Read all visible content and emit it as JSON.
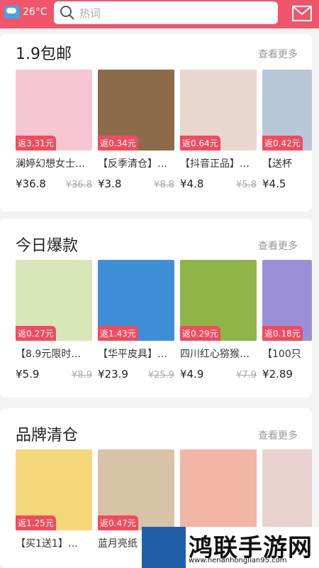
{
  "header": {
    "temperature": "26°C",
    "search_placeholder": "热词"
  },
  "sections": [
    {
      "title": "1.9包邮",
      "more": "查看更多",
      "items": [
        {
          "rebate": "返3.31元",
          "name": "澜婷幻想女士…",
          "price": "¥36.8",
          "original": "¥36.8",
          "color": "#f7c6d3"
        },
        {
          "rebate": "返0.34元",
          "name": "【反季清仓】…",
          "price": "¥3.8",
          "original": "¥8.8",
          "color": "#8c6b4b"
        },
        {
          "rebate": "返0.64元",
          "name": "【抖音正品】…",
          "price": "¥4.8",
          "original": "¥5.8",
          "color": "#e9d6cf"
        },
        {
          "rebate": "返0.42元",
          "name": "【送杯",
          "price": "¥4.5",
          "original": "",
          "color": "#b7c7d8"
        }
      ]
    },
    {
      "title": "今日爆款",
      "more": "查看更多",
      "items": [
        {
          "rebate": "返0.27元",
          "name": "【8.9元限时…",
          "price": "¥5.9",
          "original": "¥8.9",
          "color": "#d7e6b6"
        },
        {
          "rebate": "返1.43元",
          "name": "【华平皮具】…",
          "price": "¥23.9",
          "original": "¥25.9",
          "color": "#3f8fd8"
        },
        {
          "rebate": "返0.29元",
          "name": "四川红心猕猴…",
          "price": "¥4.9",
          "original": "¥7.9",
          "color": "#8fb548"
        },
        {
          "rebate": "返0.18元",
          "name": "【100只",
          "price": "¥2.89",
          "original": "",
          "color": "#9b8fd8"
        }
      ]
    },
    {
      "title": "品牌清仓",
      "more": "查看更多",
      "items": [
        {
          "rebate": "返1.25元",
          "name": "【买1送1】…",
          "price": "",
          "original": "",
          "color": "#f6d77a"
        },
        {
          "rebate": "返0.47元",
          "name": "蓝月亮纸",
          "price": "",
          "original": "",
          "color": "#d9c3a6"
        },
        {
          "rebate": "",
          "name": "",
          "price": "",
          "original": "",
          "color": "#f1b6a6"
        },
        {
          "rebate": "",
          "name": "",
          "price": "",
          "original": "",
          "color": "#e9d2cf"
        }
      ]
    }
  ],
  "watermark": {
    "text": "鸿联手游网",
    "url": "www.henanhonglian95.com"
  }
}
